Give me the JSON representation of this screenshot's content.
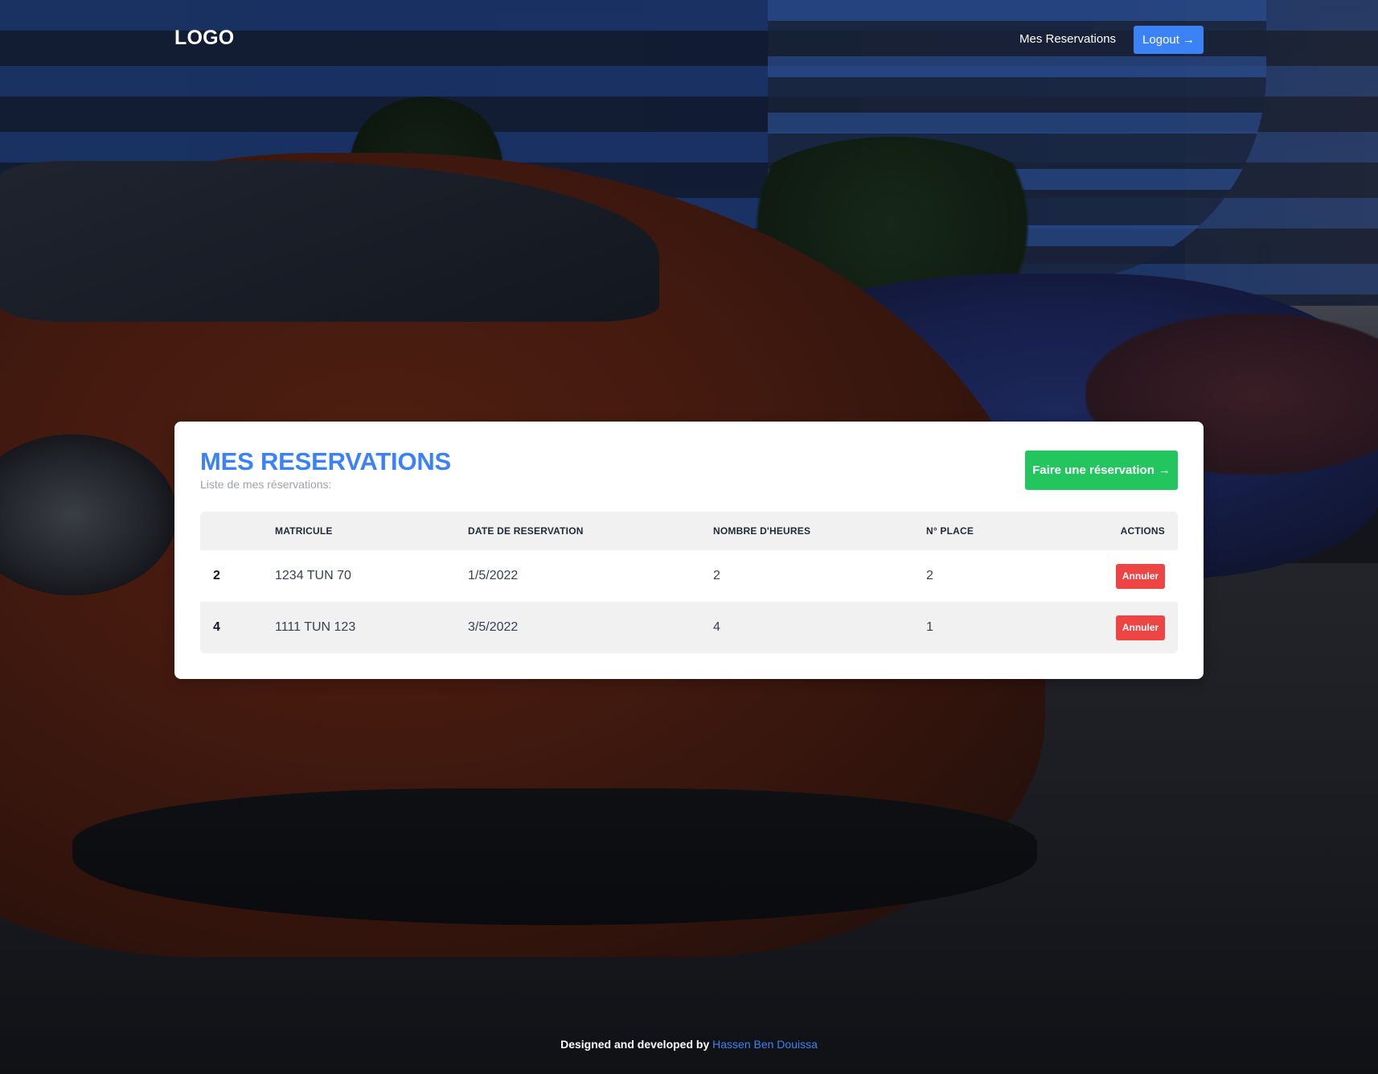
{
  "header": {
    "logo": "LOGO",
    "nav_link": "Mes Reservations",
    "logout_label": "Logout",
    "logout_arrow": "→"
  },
  "card": {
    "title": "MES RESERVATIONS",
    "subtitle": "Liste de mes réservations:",
    "reserve_label": "Faire une réservation",
    "reserve_arrow": "→"
  },
  "table": {
    "columns": [
      "",
      "MATRICULE",
      "DATE DE RESERVATION",
      "NOMBRE D'HEURES",
      "N° PLACE",
      "ACTIONS"
    ],
    "rows": [
      {
        "id": "2",
        "matricule": "1234 TUN 70",
        "date": "1/5/2022",
        "heures": "2",
        "place": "2",
        "action": "Annuler"
      },
      {
        "id": "4",
        "matricule": "1111 TUN 123",
        "date": "3/5/2022",
        "heures": "4",
        "place": "1",
        "action": "Annuler"
      }
    ]
  },
  "footer": {
    "prefix": "Designed and developed by",
    "author": "Hassen Ben Douissa"
  },
  "colors": {
    "primary": "#3b82f6",
    "success": "#22c55e",
    "danger": "#ef4444"
  }
}
